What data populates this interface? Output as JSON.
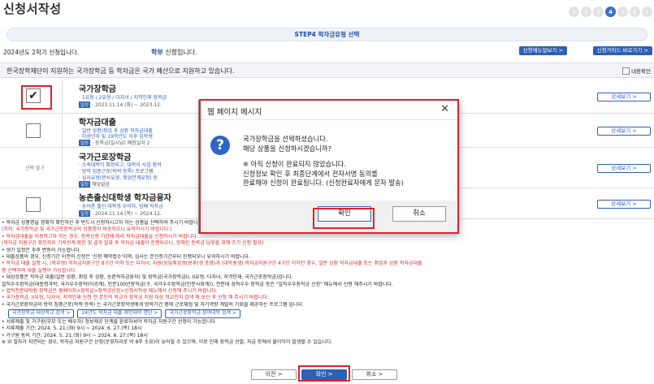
{
  "page": {
    "title": "신청서작성"
  },
  "steps": [
    "1",
    "2",
    "3",
    "4",
    "5",
    "6",
    "7"
  ],
  "active_step": "4",
  "step_bar": {
    "text": "STEP4 학자금유형 선택"
  },
  "info": {
    "year_semester": "2024년도 2학기 신청입니다.",
    "type_prefix": "학부",
    "type_suffix": " 신청입니다.",
    "btn_manual": "신청매뉴얼보기 >",
    "btn_guide": "신청가이드 바로가기 >"
  },
  "kosaf": {
    "text": "한국장학재단이 지원하는 국가장학금 등 학자금은 국가 예산으로 지원하고 있습니다.",
    "check_label": "내용확인"
  },
  "rows": [
    {
      "name": "국가장학금",
      "line1": "· 1유형 / 2유형 / 다자녀 / 지역인재 장학금",
      "tag": "일정",
      "line2": "· 2023.11.14.(화) ~ 2023.12.",
      "detail": "상세보기 >",
      "checked": "✔"
    },
    {
      "name": "학자금대출",
      "line1": "· 일반 상환/취업 후 상환 학자금대출",
      "line1b": "· 미성년자 및 19학년도 이후 입학생",
      "tag": "일정",
      "line2": "· 등록금(일시납) 예정일자 2",
      "detail": "상세보기 >",
      "checked": ""
    },
    {
      "name": "국가근로장학금",
      "line1": "· 소속대학이 확정되고, 대학이 사업 참여",
      "line1b": "· 방학 집중근로(학적·등록) 프로그램",
      "line1c": "· 심사유형(분사유형, 취업연계유형) 등",
      "tag": "일정",
      "line2": "해당없음",
      "detail": "상세보기 >",
      "gray_label": "선택 불가"
    },
    {
      "name": "농촌출신대학생 학자금융자",
      "line1": "· 농어촌 출신 대학생 우이자, 담배 학자금",
      "tag": "일정",
      "line2": "· 2024.11.14.(목) ~ 2024.12.",
      "detail": "상세보기 >",
      "checked": ""
    }
  ],
  "notes": [
    "• 학자금 상품명을 정확히 확인하신 후 반드시 신청하시고자 하는 상품을 선택하여 주시기 바랍니다.",
    "(주의: 국가장학금 및 국가근로장학금의 상품명이 비슷하오니 유의하시기 바랍니다.)",
    "• 학자금대출을 이용하고자 하는 경우, 등록신청 기간에 따라 학자금대출을 신청하시기 바랍니다.",
    "(학자금 지원구간 확인까지 기록관계 확인 및 결과 발표 후 학자금 대출이 진행되오니, 정해진 등록금 납부를 위해 조기 신청 필요)",
    "• 생기 일정은 추후 변동이 가능합니다.",
    "• 대출상품의 경우, 신청기간 이전의 신청은 '신청 예약접수'이며, 심사는 본신청기간부터 진행되오니 유의하시기 바랍니다.",
    "• 학자금 대출 실행 시, (학부생) 학자금지원구간 8구간 이하 또는 다자녀, 지원(응답취업생(보후(생 포함)과 (대학원생) 학자금지원구간 4구간 이하인 경우, 일반 상환 학자금대출 또는 취업후 상환 학자금대출",
    "중 선택하여 대출 실행이 가능합니다.",
    "• 대상상품은 학자금 대출(일반 상환, 취업 후 상환, 농촌학자금융자) 및 장학금(국가장학금(I, II유형, 다자녀, 지역인재, 국가근로장학금)입니다.",
    "설직수수장학금(대통령과학, 국가우수장학(이공계), 인문100년장학금(구, 국가우수장학금(인문사회계)), 전문대 성적우수 장학금 등은 \"설직우수장학금 신청\" 메뉴에서 신청 해주시기 바랍니다.",
    "• 법학전문대학원 장학금은 홈페이지>장학금>장학금신청>신청서작성 메뉴에서 신청해 주시기 바랍니다.",
    "• 국가장학금, II유형, 다자녀, 지역인재 신청 전 본인의 학교가 장학금 지원 대상 학교인지 검색 해 보신 후 신청 해 주시기 바랍니다.",
    "• 국가근로장학금의 방학 집중근로(학적·등록) 는 국가근로장학생에게 방학기간 중에 근로체험 및 자기역량 계발의 기회를 제공하는 프로그램 입니다."
  ],
  "note_buttons": [
    "국가장학금 대상학교 검색 >",
    "24년도 학자금 대출 제한대학 명단 >",
    "국가근로장학금 참여대학 검색 >"
  ],
  "notes2": [
    "• 서류제출 및 가구원(부모 또는 배우자) 정보제공 단계를 완료하셔야 학자금 지원구간 산정이 가능합니다",
    "• 서류제출 기간: 2024. 5. 21.(화) 9시 ~ 2024. 6. 27.(목) 18시",
    "• 가구원 동의 기간: 2024. 5. 21.(화) 9시 ~ 2024. 6. 27.(목) 18시",
    "※ 위 절차가 지연되는 경우, 학자금 지원구간 산정(운영처리로 약 8주 소요)이 늦어질 수 있으며, 이로 인해 장학금 선발, 지급 등에서 불이익이 발생할 수 있습니다."
  ],
  "bottom": {
    "prev": "이전 >",
    "confirm": "확인 >",
    "cancel": "취소 >"
  },
  "dialog": {
    "title": "웹 페이지 메시지",
    "close": "✕",
    "icon": "?",
    "line1": "국가장학금을 선택하셨습니다.",
    "line2": "해당 상품을 신청하시겠습니까?",
    "line3": "※ 아직 신청이 완료되지 않았습니다.",
    "line4": "신청정보 확인 후 최종단계에서 전자서명 동의를",
    "line5": "완료해야 신청이 완료됩니다. (신청완료자에게 문자 발송)",
    "ok": "확인",
    "cancel": "취소"
  },
  "colors": {
    "accent": "#2f5fb3",
    "highlight": "#e0202a",
    "step_active": "#3a6fc4"
  }
}
